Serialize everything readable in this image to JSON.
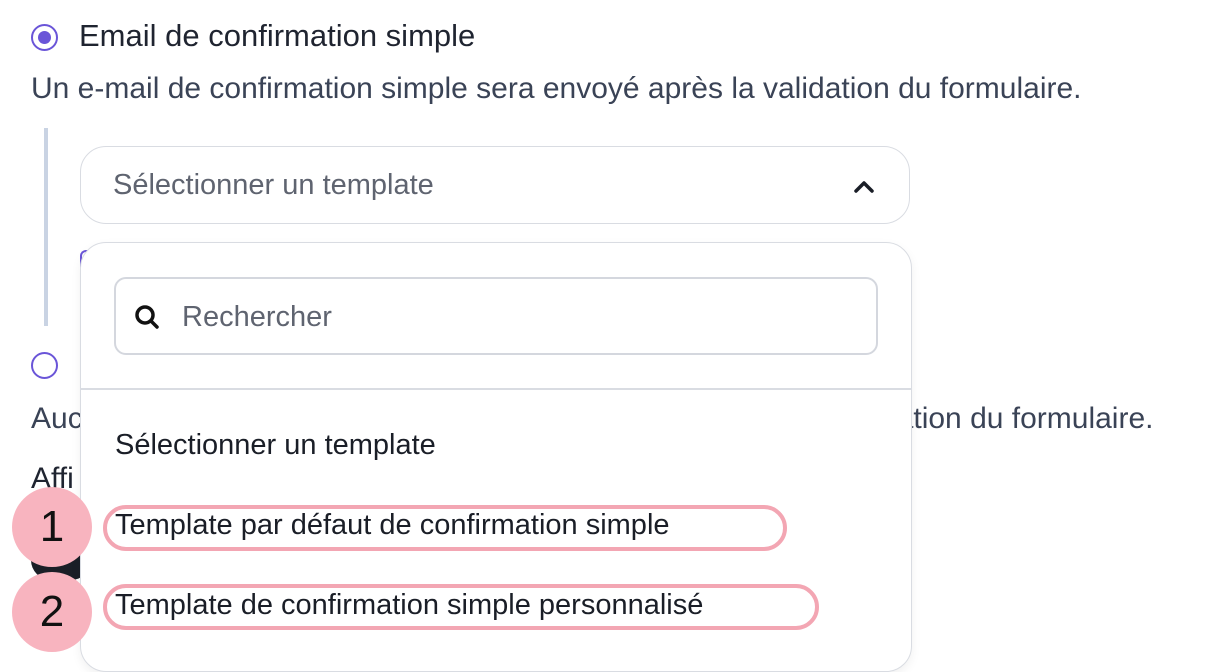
{
  "option1": {
    "title": "Email de confirmation simple",
    "description": "Un e-mail de confirmation simple sera envoyé après la validation du formulaire."
  },
  "option2": {
    "description_visible_left": "Auc",
    "description_visible_right": "dation du formulaire.",
    "next_label_left": "Affi"
  },
  "select": {
    "placeholder": "Sélectionner un template"
  },
  "dropdown": {
    "search_placeholder": "Rechercher",
    "items": [
      "Sélectionner un template",
      "Template par défaut de confirmation simple",
      "Template de confirmation simple personnalisé"
    ]
  },
  "badges": [
    "1",
    "2"
  ],
  "colors": {
    "accent": "#6a55d8",
    "highlight": "#f3a6b3",
    "badge": "#f8b4bf"
  }
}
